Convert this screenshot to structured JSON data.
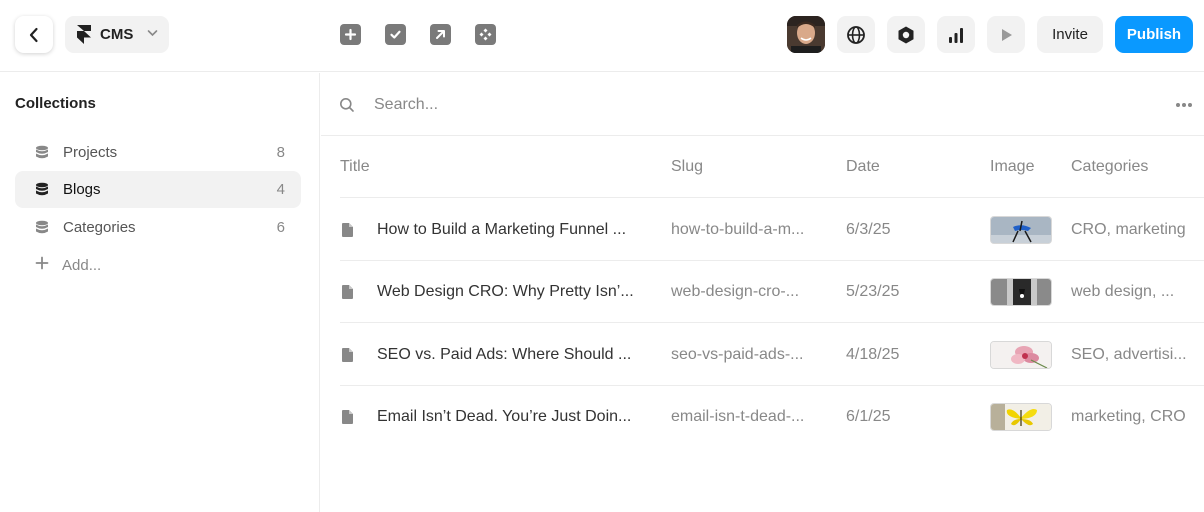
{
  "topbar": {
    "project_label": "CMS",
    "invite_label": "Invite",
    "publish_label": "Publish",
    "tools": [
      "plus-square-icon",
      "check-square-icon",
      "arrow-up-right-square-icon",
      "components-icon"
    ],
    "right_icons": [
      "globe-icon",
      "settings-hexagon-icon",
      "bar-chart-icon",
      "play-icon"
    ]
  },
  "sidebar": {
    "title": "Collections",
    "items": [
      {
        "label": "Projects",
        "count": "8"
      },
      {
        "label": "Blogs",
        "count": "4"
      },
      {
        "label": "Categories",
        "count": "6"
      }
    ],
    "add_label": "Add..."
  },
  "search": {
    "placeholder": "Search..."
  },
  "table": {
    "headers": [
      "Title",
      "Slug",
      "Date",
      "Image",
      "Categories"
    ],
    "rows": [
      {
        "title": "How to Build a Marketing Funnel ...",
        "slug": "how-to-build-a-m...",
        "date": "6/3/25",
        "image": "chair-thumbnail",
        "categories": "CRO, marketing"
      },
      {
        "title": "Web Design CRO: Why Pretty Isn’...",
        "slug": "web-design-cro-...",
        "date": "5/23/25",
        "image": "lamp-thumbnail",
        "categories": "web design, ..."
      },
      {
        "title": "SEO vs. Paid Ads: Where Should ...",
        "slug": "seo-vs-paid-ads-...",
        "date": "4/18/25",
        "image": "flower-thumbnail",
        "categories": "SEO, advertisi..."
      },
      {
        "title": "Email Isn’t Dead. You’re Just Doin...",
        "slug": "email-isn-t-dead-...",
        "date": "6/1/25",
        "image": "butterfly-thumbnail",
        "categories": "marketing, CRO"
      }
    ]
  },
  "colors": {
    "accent": "#0a99ff",
    "muted": "#888888",
    "hover_bg": "#f2f2f2"
  }
}
